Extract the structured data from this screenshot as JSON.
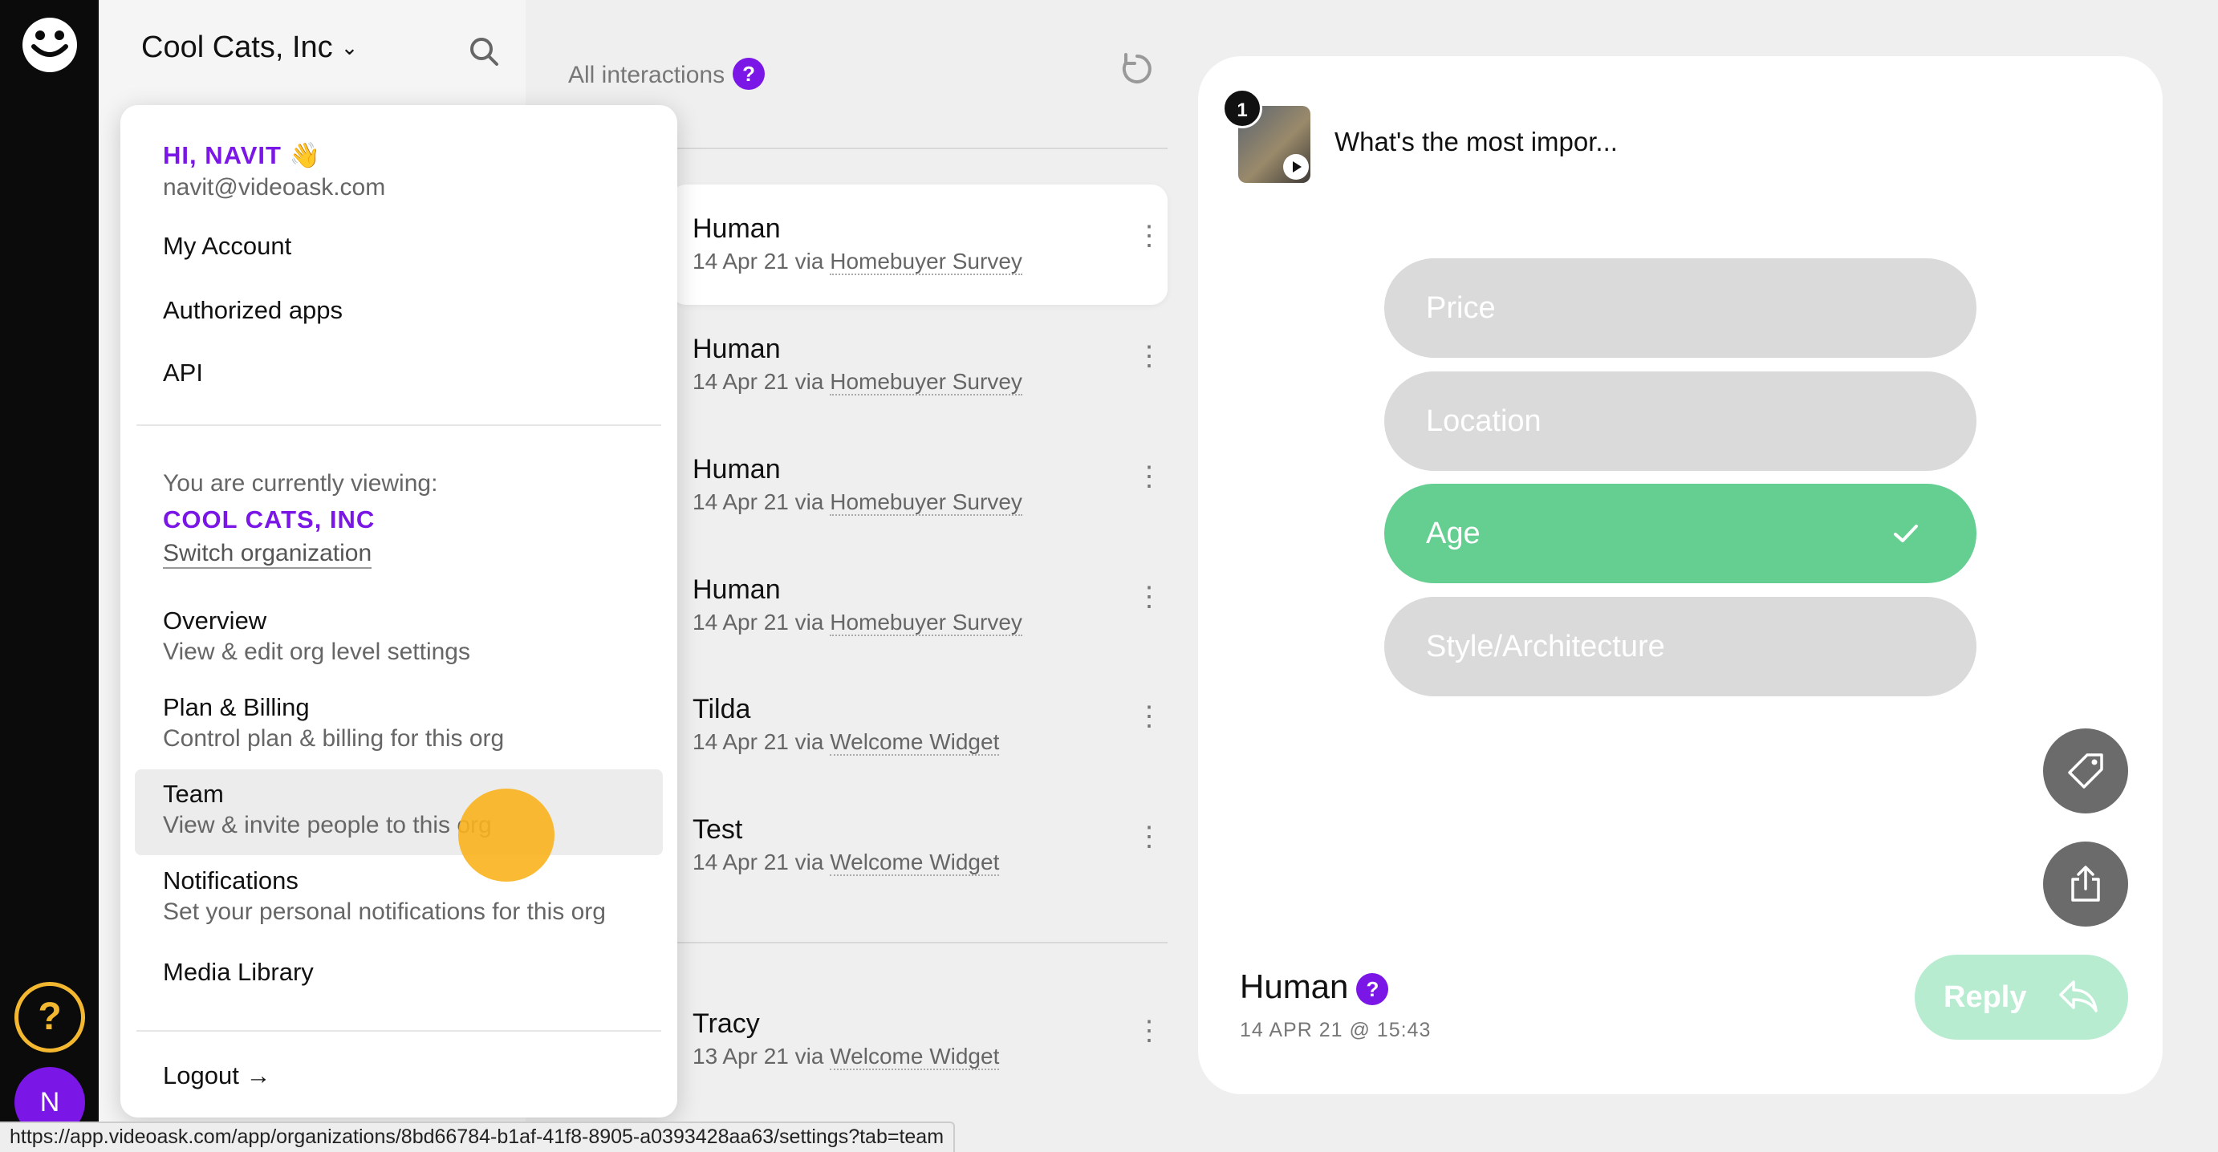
{
  "org": {
    "name": "Cool Cats, Inc"
  },
  "list": {
    "title": "All interactions",
    "help_badge": "?",
    "cards": [
      {
        "name": "Human",
        "date": "14 Apr 21 via",
        "source": "Homebuyer Survey"
      },
      {
        "name": "Human",
        "date": "14 Apr 21 via",
        "source": "Homebuyer Survey"
      },
      {
        "name": "Human",
        "date": "14 Apr 21 via",
        "source": "Homebuyer Survey"
      },
      {
        "name": "Human",
        "date": "14 Apr 21 via",
        "source": "Homebuyer Survey"
      },
      {
        "name": "Tilda",
        "date": "14 Apr 21 via",
        "source": "Welcome Widget"
      },
      {
        "name": "Test",
        "date": "14 Apr 21 via",
        "source": "Welcome Widget"
      },
      {
        "name": "Tracy",
        "date": "13 Apr 21 via",
        "source": "Welcome Widget"
      }
    ]
  },
  "menu": {
    "greeting": "HI, NAVIT 👋",
    "email": "navit@videoask.com",
    "my_account": "My Account",
    "authorized_apps": "Authorized apps",
    "api": "API",
    "viewing_label": "You are currently viewing:",
    "current_org": "COOL CATS, INC",
    "switch_org": "Switch organization",
    "items": [
      {
        "title": "Overview",
        "sub": "View & edit org level settings"
      },
      {
        "title": "Plan & Billing",
        "sub": "Control plan & billing for this org"
      },
      {
        "title": "Team",
        "sub": "View & invite people to this org"
      },
      {
        "title": "Notifications",
        "sub": "Set your personal notifications for this org"
      }
    ],
    "media_library": "Media Library",
    "logout": "Logout →"
  },
  "detail": {
    "step_number": "1",
    "question": "What's the most impor...",
    "options": [
      {
        "label": "Price",
        "selected": false
      },
      {
        "label": "Location",
        "selected": false
      },
      {
        "label": "Age",
        "selected": true
      },
      {
        "label": "Style/Architecture",
        "selected": false
      }
    ],
    "respondent": "Human",
    "respondent_badge": "?",
    "timestamp": "14 APR 21 @ 15:43",
    "reply_label": "Reply"
  },
  "sidebar": {
    "help_label": "?",
    "avatar_initial": "N"
  },
  "status_bar": {
    "url": "https://app.videoask.com/app/organizations/8bd66784-b1af-41f8-8905-a0393428aa63/settings?tab=team"
  },
  "colors": {
    "brand_purple": "#7a16e6",
    "selected_green": "#65cf92",
    "reply_green": "#b7ecd1",
    "cursor_highlight": "#fbb21e"
  }
}
